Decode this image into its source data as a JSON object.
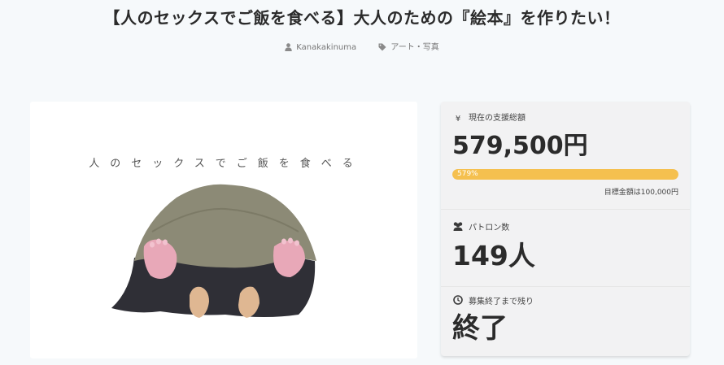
{
  "page": {
    "title": "【人のセックスでご飯を食べる】大人のための『絵本』を作りたい！",
    "author": "Kanakakinuma",
    "category": "アート・写真"
  },
  "image": {
    "book_title": "人のセックスでご飯を食べる"
  },
  "stats": {
    "raised_label": "現在の支援総額",
    "raised_amount": "579,500円",
    "progress_text": "579%",
    "progress_fraction": 1.0,
    "goal_text": "目標金額は100,000円",
    "patrons_label": "パトロン数",
    "patrons_value": "149人",
    "remaining_label": "募集終了まで残り",
    "remaining_value": "終了"
  },
  "icons": {
    "author": "user-icon",
    "category": "tag-icon",
    "raised": "yen-icon",
    "patrons": "users-icon",
    "remaining": "clock-icon"
  },
  "colors": {
    "accent": "#f5c04f",
    "background": "#f6f9fb",
    "card": "#f2f2f3"
  }
}
